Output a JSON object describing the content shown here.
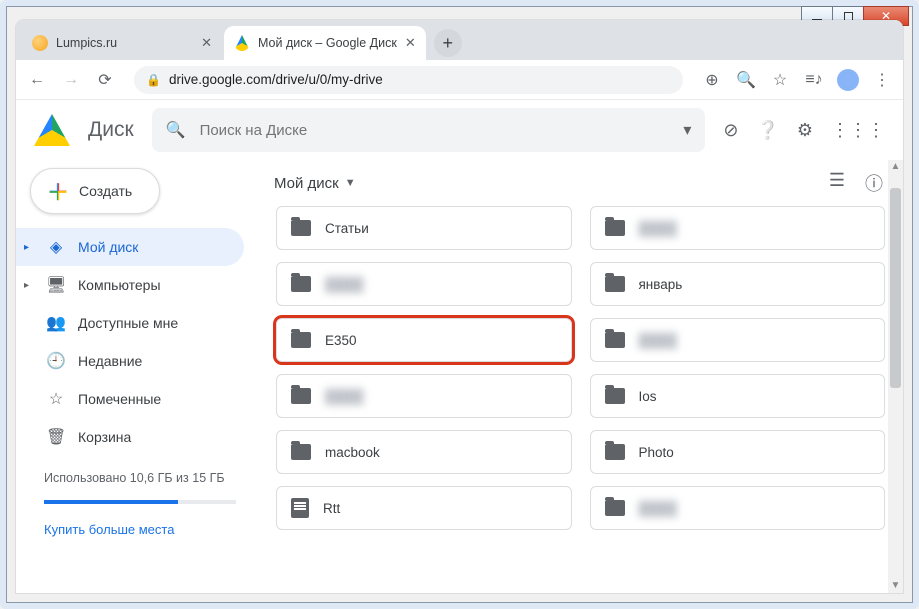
{
  "window": {
    "title": "Мой диск – Google Диск"
  },
  "tabs": [
    {
      "label": "Lumpics.ru",
      "active": false
    },
    {
      "label": "Мой диск – Google Диск",
      "active": true
    }
  ],
  "addressbar": {
    "url": "drive.google.com/drive/u/0/my-drive"
  },
  "app": {
    "name": "Диск",
    "search_placeholder": "Поиск на Диске"
  },
  "sidebar": {
    "create_label": "Создать",
    "items": [
      {
        "icon": "drive",
        "label": "Мой диск",
        "active": true,
        "expandable": true
      },
      {
        "icon": "computers",
        "label": "Компьютеры",
        "expandable": true
      },
      {
        "icon": "shared",
        "label": "Доступные мне"
      },
      {
        "icon": "recent",
        "label": "Недавние"
      },
      {
        "icon": "starred",
        "label": "Помеченные"
      },
      {
        "icon": "trash",
        "label": "Корзина"
      }
    ],
    "storage_text": "Использовано 10,6 ГБ из 15 ГБ",
    "storage_pct": 70,
    "buy_label": "Купить больше места"
  },
  "breadcrumb": {
    "label": "Мой диск"
  },
  "folders": [
    {
      "name": "Статьи",
      "type": "folder"
    },
    {
      "name": "",
      "type": "folder",
      "blur": true
    },
    {
      "name": "",
      "type": "folder",
      "blur": true
    },
    {
      "name": "январь",
      "type": "folder"
    },
    {
      "name": "E350",
      "type": "folder",
      "highlight": true
    },
    {
      "name": "",
      "type": "folder",
      "blur": true
    },
    {
      "name": "",
      "type": "folder",
      "blur": true
    },
    {
      "name": "Ios",
      "type": "folder"
    },
    {
      "name": "macbook",
      "type": "folder"
    },
    {
      "name": "Photo",
      "type": "folder"
    },
    {
      "name": "Rtt",
      "type": "file"
    },
    {
      "name": "",
      "type": "folder",
      "blur": true
    }
  ],
  "colors": {
    "accent": "#1a73e8",
    "highlight": "#d9351c"
  }
}
